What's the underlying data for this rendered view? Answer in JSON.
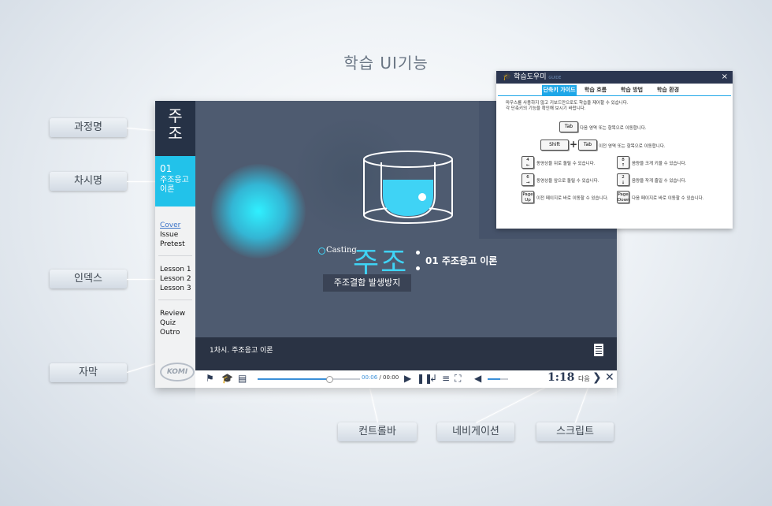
{
  "page_title": "학습 UI기능",
  "callouts": {
    "course_name": "과정명",
    "session_name": "차시명",
    "index": "인덱스",
    "caption": "자막",
    "control_bar": "컨트롤바",
    "navigation": "네비게이션",
    "script": "스크립트"
  },
  "player": {
    "course_title": "주조",
    "session_number": "01",
    "session_title": "주조응고 이론",
    "index_groups": [
      [
        "Cover",
        "Issue",
        "Pretest"
      ],
      [
        "Lesson 1",
        "Lesson 2",
        "Lesson 3"
      ],
      [
        "Review",
        "Quiz",
        "Outro"
      ]
    ],
    "logo_text": "KOMI",
    "hero": {
      "casting_label": "Casting",
      "main_title": "주조",
      "chapter": "01 주조응고 이론",
      "tagline": "주조결함 발생방지"
    },
    "caption_text": "1차시. 주조응고 이론",
    "script_icon": "document-icon",
    "time_current": "00:06",
    "time_total": "00:00",
    "progress": 0.7,
    "volume": 0.6,
    "page_indicator": "1:18",
    "next_label": "다음"
  },
  "helper": {
    "title": "학습도우미",
    "title_sub": "GUIDE",
    "close_label": "×",
    "tabs": [
      "단축키 가이드",
      "학습 흐름",
      "학습 방법",
      "학습 환경"
    ],
    "active_tab": 0,
    "intro_line1": "마우스를 사용하지 않고 키보드만으로도 학습을 제어할 수 있습니다.",
    "intro_line2": "각 단축키의 기능을 확인해 보시기 바랍니다.",
    "tab_key": "Tab",
    "tab_desc": "다음 영역 또는 항목으로 이동합니다.",
    "shift_key": "Shift",
    "plus": "+",
    "shift_tab_desc": "이전 영역 또는 항목으로 이동합니다.",
    "keys": [
      {
        "top": "4",
        "bottom": "←",
        "desc": "동영상을 뒤로 돌릴 수 있습니다."
      },
      {
        "top": "8",
        "bottom": "↑",
        "desc": "음량을 크게 키울 수 있습니다."
      },
      {
        "top": "6",
        "bottom": "→",
        "desc": "동영상을 앞으로 돌릴 수 있습니다."
      },
      {
        "top": "2",
        "bottom": "↓",
        "desc": "음량을 작게 줄일 수 있습니다."
      },
      {
        "top": "Page",
        "bottom": "Up",
        "desc": "이전 페이지로 바로 이동할 수 있습니다."
      },
      {
        "top": "Page",
        "bottom": "Down",
        "desc": "다음 페이지로 바로 이동할 수 있습니다."
      }
    ]
  },
  "colors": {
    "accent": "#22c2ea",
    "dark": "#263246",
    "stage": "#4e5b70"
  }
}
